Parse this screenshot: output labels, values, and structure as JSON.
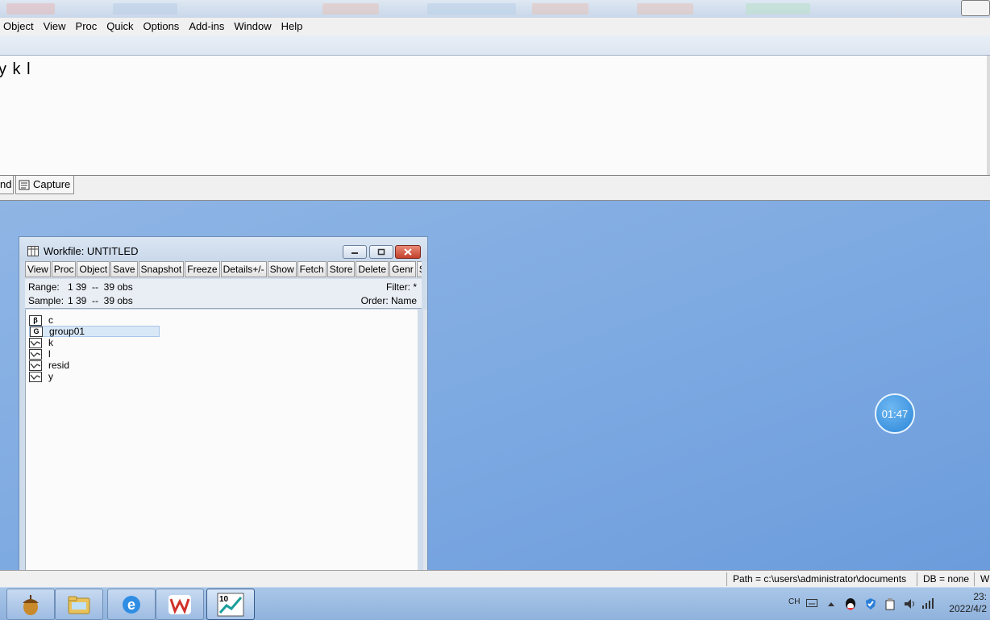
{
  "menubar": {
    "items": [
      "Object",
      "View",
      "Proc",
      "Quick",
      "Options",
      "Add-ins",
      "Window",
      "Help"
    ]
  },
  "command": {
    "text": "y k l"
  },
  "tabs": {
    "left_fragment": "nd",
    "capture": "Capture"
  },
  "workfile": {
    "title": "Workfile: UNTITLED",
    "toolbar": [
      "View",
      "Proc",
      "Object",
      "Save",
      "Snapshot",
      "Freeze",
      "Details+/-",
      "Show",
      "Fetch",
      "Store",
      "Delete",
      "Genr",
      "Sa"
    ],
    "range_label": "Range:",
    "range_value": "1 39  --  39 obs",
    "sample_label": "Sample:",
    "sample_value": "1 39  --  39 obs",
    "filter": "Filter: *",
    "order": "Order: Name",
    "objects": [
      {
        "name": "c",
        "icon": "coefficient-icon"
      },
      {
        "name": "group01",
        "icon": "group-icon",
        "selected": true
      },
      {
        "name": "k",
        "icon": "series-icon"
      },
      {
        "name": "l",
        "icon": "series-icon"
      },
      {
        "name": "resid",
        "icon": "series-icon"
      },
      {
        "name": "y",
        "icon": "series-icon"
      }
    ]
  },
  "timer": "01:47",
  "statusbar": {
    "path": "Path = c:\\users\\administrator\\documents",
    "db": "DB = none",
    "wf": "W"
  },
  "taskbar": {
    "apps": [
      "acorn-icon",
      "file-explorer-icon",
      "ie-icon",
      "wps-icon",
      "eviews-icon"
    ],
    "eviews_badge": "10",
    "ime": "CH",
    "clock_time": "23:",
    "clock_date": "2022/4/2"
  },
  "colors": {
    "desktop": "#7aa6dc",
    "close_button": "#c4412b",
    "selection": "#d9e8f7"
  }
}
